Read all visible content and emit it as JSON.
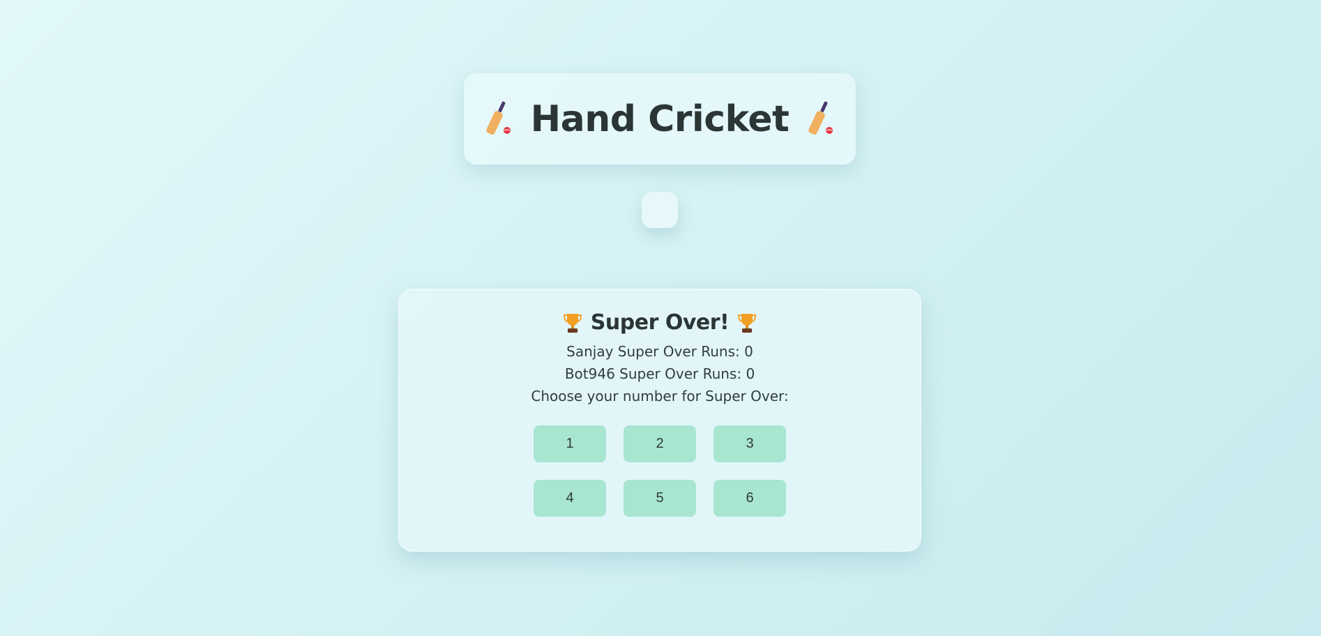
{
  "header": {
    "title": "Hand Cricket",
    "icon_left": "cricket-bat-icon",
    "icon_right": "cricket-bat-icon"
  },
  "super_over": {
    "title": "Super Over!",
    "icon": "trophy-icon",
    "player_runs": "Sanjay Super Over Runs: 0",
    "bot_runs": "Bot946 Super Over Runs: 0",
    "prompt": "Choose your number for Super Over:",
    "numbers": [
      "1",
      "2",
      "3",
      "4",
      "5",
      "6"
    ]
  },
  "colors": {
    "button_bg": "#a8e6d1",
    "text": "#2b3535",
    "bat_blade": "#f0b060",
    "bat_handle": "#4a3a6e",
    "ball": "#e53945",
    "trophy": "#f2a024"
  }
}
